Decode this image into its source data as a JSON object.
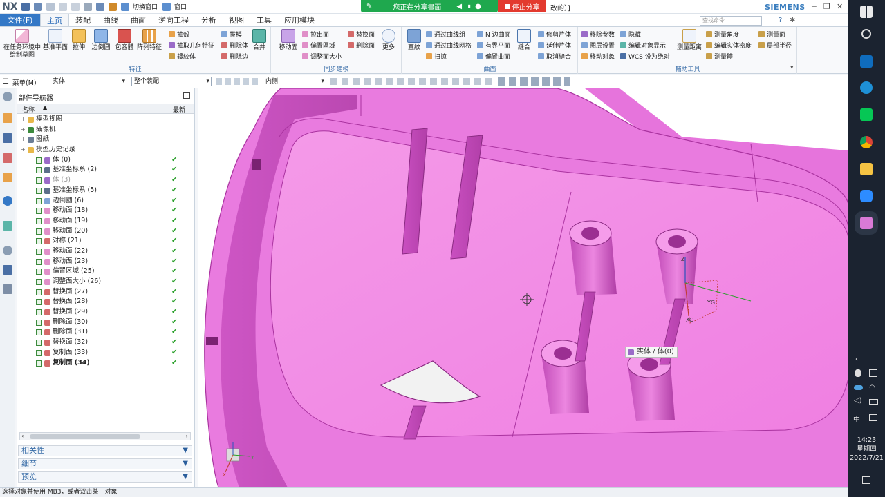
{
  "titlebar": {
    "logo": "NX",
    "switch_window": "切换窗口",
    "window_menu": "窗口",
    "sharing_text": "您正在分享畫面",
    "stop_share": "停止分享",
    "title_fragment": "改的）]",
    "brand": "SIEMENS",
    "search_placeholder": "查找命令"
  },
  "tabs": [
    "文件(F)",
    "主页",
    "装配",
    "曲线",
    "曲面",
    "逆向工程",
    "分析",
    "视图",
    "工具",
    "应用模块"
  ],
  "active_tab": "主页",
  "ribbon": {
    "feature_group": {
      "label": "特征",
      "big": [
        "在任务环境中绘制草图",
        "基准平面",
        "拉伸",
        "边倒圆",
        "包容體",
        "阵列特征"
      ],
      "small": [
        "抽殼",
        "抽取几何特征",
        "鏤紋体",
        "拔模",
        "删除体",
        "删除边",
        "合并"
      ]
    },
    "sync_group": {
      "label": "同步建模",
      "big": [
        "移动面",
        "更多"
      ],
      "small": [
        "拉出面",
        "偏置區域",
        "调整面大小",
        "替换面",
        "删除面"
      ]
    },
    "surface_group": {
      "label": "曲面",
      "big": [
        "直紋",
        "縫合"
      ],
      "small": [
        "通过曲线组",
        "通过曲线网格",
        "扫掠",
        "N 边曲面",
        "有界平面",
        "偏置曲面",
        "修剪片体",
        "延伸片体",
        "取消縫合"
      ]
    },
    "aux_group": {
      "label": "輔助工具",
      "big": [
        "测量距离"
      ],
      "small": [
        "移除参数",
        "图层设置",
        "移动对象",
        "隐藏",
        "编辑对象显示",
        "WCS 设为绝对",
        "测量角度",
        "编辑实体密度",
        "测量體",
        "测量面",
        "局部半径"
      ]
    }
  },
  "selbar": {
    "menu": "菜单(M)",
    "filter": "实体",
    "scope": "整个装配",
    "mode": "内侧"
  },
  "navigator": {
    "title": "部件导航器",
    "col_name": "名称",
    "col_latest": "最新",
    "items": [
      {
        "label": "模型视图",
        "level": 0,
        "type": "folder",
        "check": false,
        "tick": false
      },
      {
        "label": "攝像机",
        "level": 0,
        "type": "camera",
        "check": false,
        "tick": false
      },
      {
        "label": "图紙",
        "level": 0,
        "type": "drawing",
        "check": false,
        "tick": false
      },
      {
        "label": "模型历史记录",
        "level": 0,
        "type": "folder",
        "check": false,
        "tick": false
      },
      {
        "label": "体 (0)",
        "level": 1,
        "type": "body",
        "check": true,
        "tick": true
      },
      {
        "label": "基准坐标系 (2)",
        "level": 1,
        "type": "csys",
        "check": true,
        "tick": true
      },
      {
        "label": "体 (3)",
        "level": 1,
        "type": "body",
        "check": true,
        "tick": true,
        "dim": true
      },
      {
        "label": "基准坐标系 (5)",
        "level": 1,
        "type": "csys",
        "check": true,
        "tick": true
      },
      {
        "label": "边倒圆 (6)",
        "level": 1,
        "type": "blend",
        "check": true,
        "tick": true
      },
      {
        "label": "移动面 (18)",
        "level": 1,
        "type": "move",
        "check": true,
        "tick": true
      },
      {
        "label": "移动面 (19)",
        "level": 1,
        "type": "move",
        "check": true,
        "tick": true
      },
      {
        "label": "移动面 (20)",
        "level": 1,
        "type": "move",
        "check": true,
        "tick": true
      },
      {
        "label": "对称 (21)",
        "level": 1,
        "type": "mirror",
        "check": true,
        "tick": true
      },
      {
        "label": "移动面 (22)",
        "level": 1,
        "type": "move",
        "check": true,
        "tick": true
      },
      {
        "label": "移动面 (23)",
        "level": 1,
        "type": "move",
        "check": true,
        "tick": true
      },
      {
        "label": "偏置区域 (25)",
        "level": 1,
        "type": "offset",
        "check": true,
        "tick": true
      },
      {
        "label": "调整面大小 (26)",
        "level": 1,
        "type": "resize",
        "check": true,
        "tick": true
      },
      {
        "label": "替换面 (27)",
        "level": 1,
        "type": "replace",
        "check": true,
        "tick": true
      },
      {
        "label": "替换面 (28)",
        "level": 1,
        "type": "replace",
        "check": true,
        "tick": true
      },
      {
        "label": "替换面 (29)",
        "level": 1,
        "type": "replace",
        "check": true,
        "tick": true
      },
      {
        "label": "删除面 (30)",
        "level": 1,
        "type": "delete",
        "check": true,
        "tick": true
      },
      {
        "label": "删除面 (31)",
        "level": 1,
        "type": "delete",
        "check": true,
        "tick": true
      },
      {
        "label": "替换面 (32)",
        "level": 1,
        "type": "replace",
        "check": true,
        "tick": true
      },
      {
        "label": "复制面 (33)",
        "level": 1,
        "type": "copy",
        "check": true,
        "tick": true
      },
      {
        "label": "复制面 (34)",
        "level": 1,
        "type": "copy",
        "check": true,
        "tick": true,
        "bold": true
      }
    ],
    "panels": [
      "相关性",
      "细节",
      "预览"
    ]
  },
  "viewport": {
    "tooltip": "实体 / 体(0)",
    "axis_labels": {
      "z": "Z",
      "y": "YC",
      "x": "XC",
      "yg": "YG"
    },
    "model_color": "#ea7ee4"
  },
  "status": "选择对象并使用 MB3，或者双击某一对象",
  "taskbar": {
    "time": "14:23",
    "weekday": "星期四",
    "date": "2022/7/21",
    "ime": "中"
  }
}
